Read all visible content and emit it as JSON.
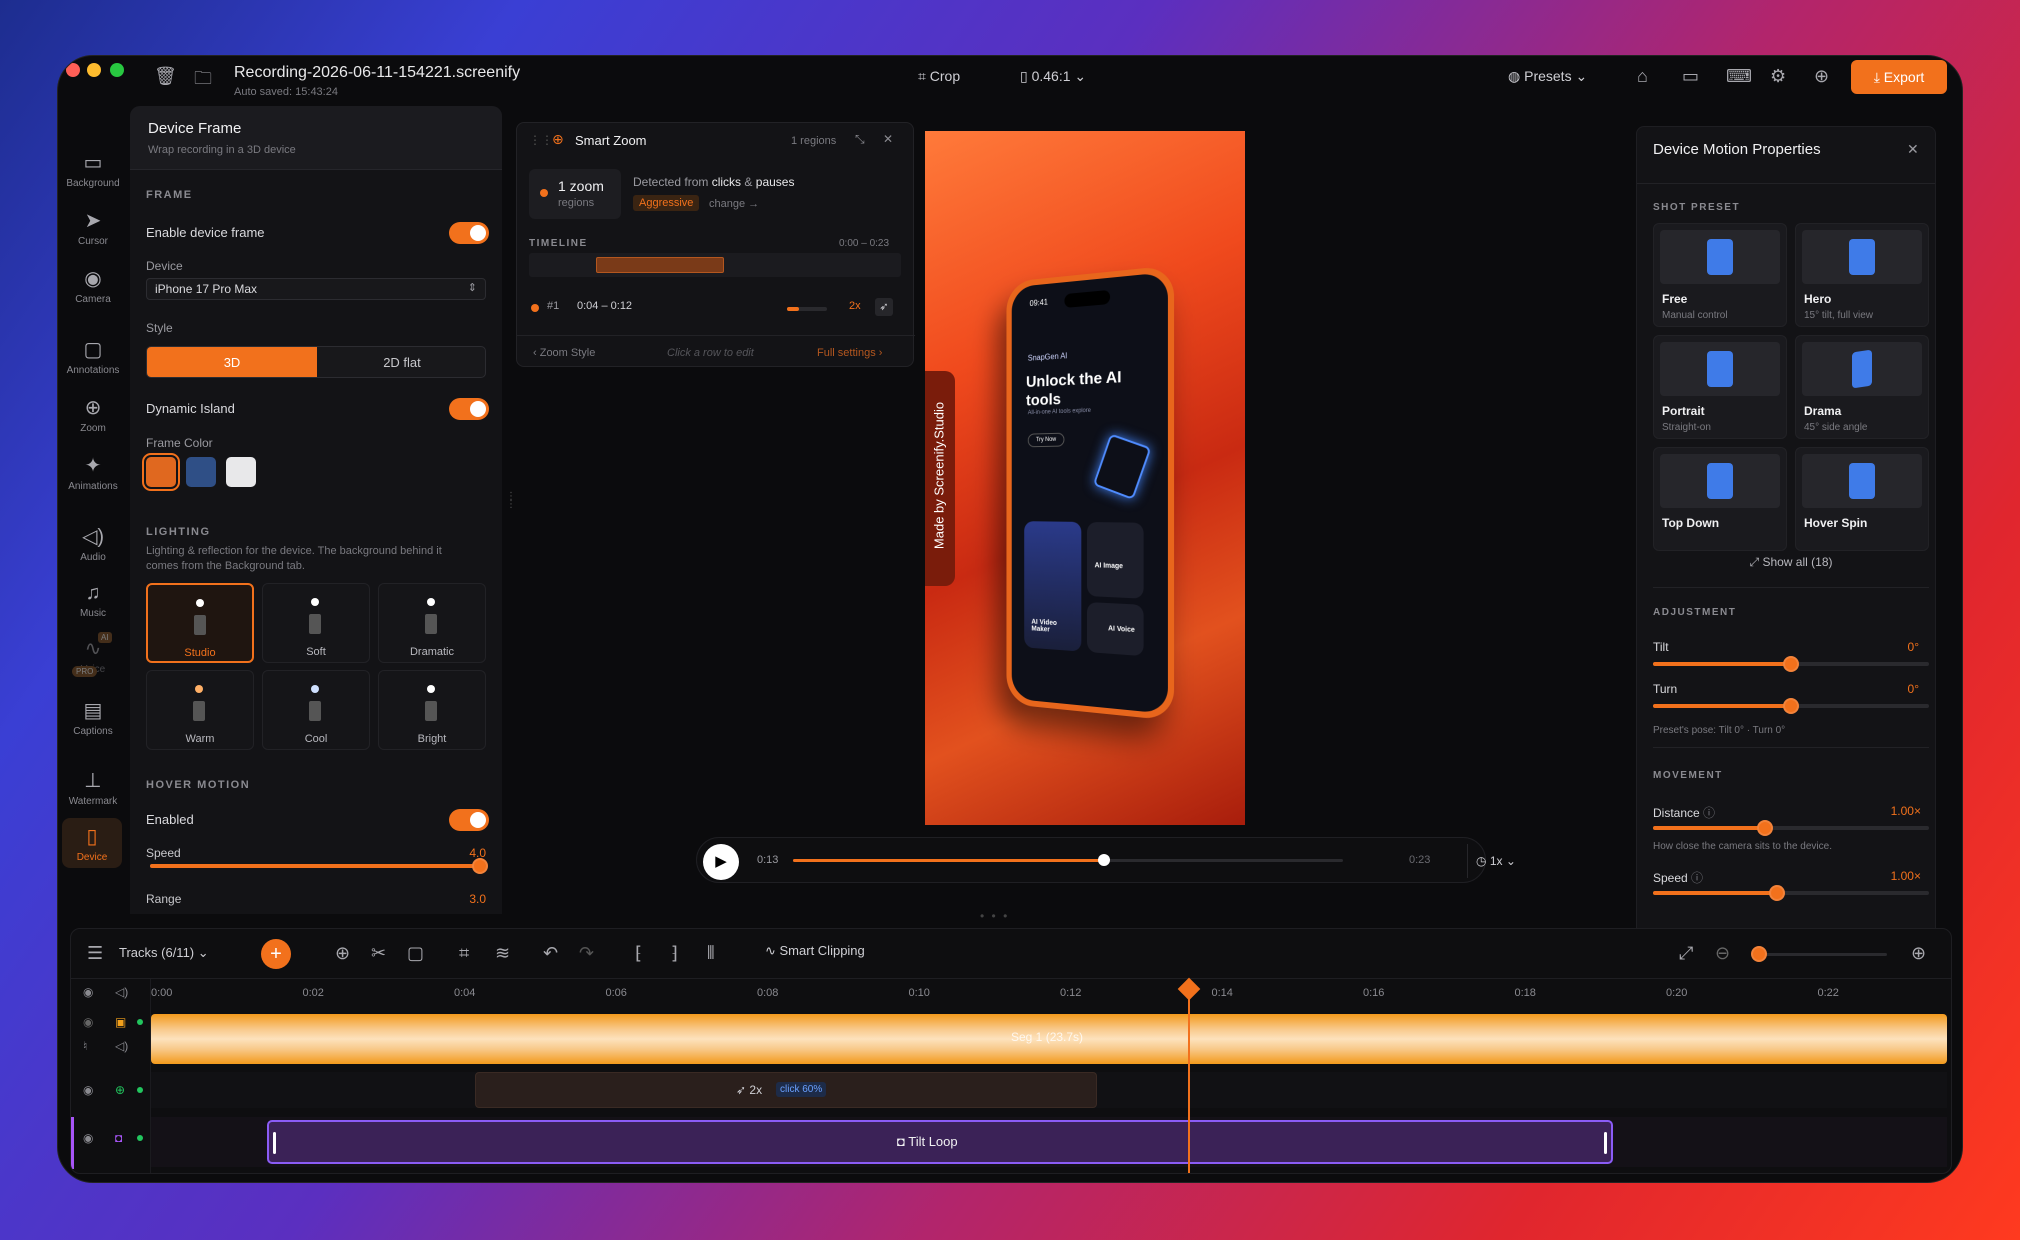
{
  "titlebar": {
    "filename": "Recording-2026-06-11-154221.screenify",
    "autosave": "Auto saved: 15:43:24",
    "crop": "Crop",
    "ratio": "0.46:1",
    "presets": "Presets",
    "export": "Export"
  },
  "sidebar": {
    "items": [
      {
        "label": "Background",
        "icon": "monitor-icon"
      },
      {
        "label": "Cursor",
        "icon": "cursor-icon"
      },
      {
        "label": "Camera",
        "icon": "camera-icon"
      },
      {
        "label": "Annotations",
        "icon": "comment-icon"
      },
      {
        "label": "Zoom",
        "icon": "zoom-icon"
      },
      {
        "label": "Animations",
        "icon": "sparkle-icon"
      },
      {
        "label": "Audio",
        "icon": "speaker-icon"
      },
      {
        "label": "Music",
        "icon": "music-icon"
      },
      {
        "label": "Voice",
        "icon": "waveform-icon",
        "badge_ai": "AI",
        "badge_pro": "PRO"
      },
      {
        "label": "Captions",
        "icon": "captions-icon"
      },
      {
        "label": "Watermark",
        "icon": "stamp-icon"
      },
      {
        "label": "Device",
        "icon": "device-icon"
      }
    ]
  },
  "device_panel": {
    "title": "Device Frame",
    "subtitle": "Wrap recording in a 3D device",
    "frame_caption": "FRAME",
    "enable_label": "Enable device frame",
    "device_label": "Device",
    "device_value": "iPhone 17 Pro Max",
    "style_label": "Style",
    "style_3d": "3D",
    "style_2d": "2D flat",
    "dynamic_island": "Dynamic Island",
    "frame_color": "Frame Color",
    "colors": [
      "#e0681f",
      "#2f4f86",
      "#e8e8ea"
    ],
    "lighting_caption": "LIGHTING",
    "lighting_desc": "Lighting & reflection for the device. The background behind it comes from the Background tab.",
    "lights": [
      "Studio",
      "Soft",
      "Dramatic",
      "Warm",
      "Cool",
      "Bright"
    ],
    "hover_caption": "HOVER MOTION",
    "hover_enabled": "Enabled",
    "speed_label": "Speed",
    "speed_value": "4.0",
    "speed_fraction": 1.0,
    "range_label": "Range",
    "range_value": "3.0"
  },
  "smart_zoom": {
    "title": "Smart Zoom",
    "regions": "1 regions",
    "zoom_count": "1 zoom",
    "zoom_unit": "regions",
    "detected_prefix": "Detected from",
    "detected_clicks": "clicks",
    "detected_amp": "&",
    "detected_pauses": "pauses",
    "mode": "Aggressive",
    "change": "change →",
    "timeline_caption": "TIMELINE",
    "timeline_range": "0:00 – 0:23",
    "row_id": "#1",
    "row_time": "0:04 – 0:12",
    "row_zoom": "2x",
    "footer_left": "‹ Zoom Style",
    "footer_mid": "Click a row to edit",
    "footer_right": "Full settings ›"
  },
  "preview": {
    "watermark": "Made by Screenify.Studio",
    "phone_time": "09:41",
    "app_name": "SnapGen AI",
    "headline": "Unlock the AI tools",
    "subline": "All-in-one AI tools explore",
    "try_now": "Try Now",
    "card1": "AI Image",
    "card2": "AI Video Maker",
    "card3": "AI Voice"
  },
  "playback": {
    "current": "0:13",
    "total": "0:23",
    "speed": "1x",
    "progress": 0.565
  },
  "motion_panel": {
    "title": "Device Motion Properties",
    "shot_caption": "SHOT PRESET",
    "presets": [
      {
        "name": "Free",
        "desc": "Manual control"
      },
      {
        "name": "Hero",
        "desc": "15° tilt, full view"
      },
      {
        "name": "Portrait",
        "desc": "Straight-on"
      },
      {
        "name": "Drama",
        "desc": "45° side angle"
      },
      {
        "name": "Top Down",
        "desc": ""
      },
      {
        "name": "Hover Spin",
        "desc": ""
      }
    ],
    "show_all": "Show all (18)",
    "adjust_caption": "ADJUSTMENT",
    "tilt_label": "Tilt",
    "tilt_value": "0°",
    "turn_label": "Turn",
    "turn_value": "0°",
    "pose": "Preset's pose: Tilt 0° · Turn 0°",
    "movement_caption": "MOVEMENT",
    "distance_label": "Distance",
    "distance_value": "1.00×",
    "distance_desc": "How close the camera sits to the device.",
    "speed_label": "Speed",
    "speed_value": "1.00×"
  },
  "timeline": {
    "tracks_label": "Tracks (6/11)",
    "smart_clipping": "Smart Clipping",
    "ticks": [
      "0:00",
      "0:02",
      "0:04",
      "0:06",
      "0:08",
      "0:10",
      "0:12",
      "0:14",
      "0:16",
      "0:18",
      "0:20",
      "0:22"
    ],
    "seg_label": "Seg 1 (23.7s)",
    "zoom_clip": "2x",
    "zoom_clip_badge": "click 60%",
    "tilt_clip": "Tilt Loop"
  },
  "colors": {
    "accent": "#f2711c",
    "panel": "#131316",
    "bg": "#0b0b0d"
  }
}
